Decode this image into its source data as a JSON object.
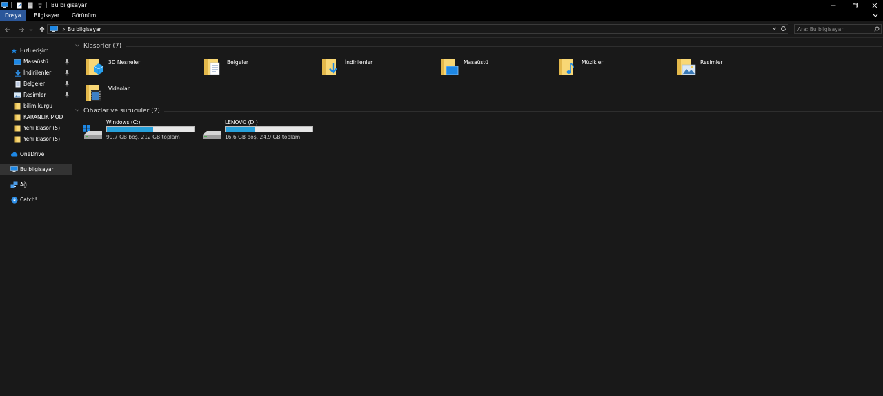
{
  "window": {
    "title": "Bu bilgisayar"
  },
  "ribbon": {
    "tabs": [
      {
        "label": "Dosya",
        "active": true
      },
      {
        "label": "Bilgisayar",
        "active": false
      },
      {
        "label": "Görünüm",
        "active": false
      }
    ]
  },
  "address": {
    "breadcrumb": "Bu bilgisayar",
    "search_placeholder": "Ara: Bu bilgisayar"
  },
  "sidebar": {
    "items": [
      {
        "label": "Hızlı erişim",
        "icon": "star-icon"
      },
      {
        "label": "Masaüstü",
        "icon": "desktop-icon",
        "pinned": true
      },
      {
        "label": "İndirilenler",
        "icon": "download-icon",
        "pinned": true
      },
      {
        "label": "Belgeler",
        "icon": "document-icon",
        "pinned": true
      },
      {
        "label": "Resimler",
        "icon": "pictures-icon",
        "pinned": true
      },
      {
        "label": "bilim kurgu",
        "icon": "folder-icon"
      },
      {
        "label": "KARANLIK MOD",
        "icon": "folder-icon"
      },
      {
        "label": "Yeni klasör (5)",
        "icon": "folder-icon"
      },
      {
        "label": "Yeni klasör (5)",
        "icon": "folder-icon"
      },
      {
        "label": "OneDrive",
        "icon": "cloud-icon"
      },
      {
        "label": "Bu bilgisayar",
        "icon": "computer-icon",
        "selected": true
      },
      {
        "label": "Ağ",
        "icon": "network-icon"
      },
      {
        "label": "Catch!",
        "icon": "catch-icon"
      }
    ]
  },
  "folders": {
    "header": "Klasörler (7)",
    "items": [
      {
        "label": "3D Nesneler",
        "icon": "3d-objects-folder-icon"
      },
      {
        "label": "Belgeler",
        "icon": "documents-folder-icon"
      },
      {
        "label": "İndirilenler",
        "icon": "downloads-folder-icon"
      },
      {
        "label": "Masaüstü",
        "icon": "desktop-folder-icon"
      },
      {
        "label": "Müzikler",
        "icon": "music-folder-icon"
      },
      {
        "label": "Resimler",
        "icon": "pictures-folder-icon"
      },
      {
        "label": "Videolar",
        "icon": "videos-folder-icon"
      }
    ]
  },
  "drives": {
    "header": "Cihazlar ve sürücüler (2)",
    "items": [
      {
        "name": "Windows (C:)",
        "info": "99,7 GB boş, 212 GB toplam",
        "used_fraction": 0.53,
        "icon": "windows-drive-icon"
      },
      {
        "name": "LENOVO (D:)",
        "info": "16,6 GB boş, 24,9 GB toplam",
        "used_fraction": 0.33,
        "icon": "drive-icon"
      }
    ]
  },
  "colors": {
    "accent": "#2b579a",
    "drive_fill": "#26a0da",
    "folder": "#f8d775"
  }
}
